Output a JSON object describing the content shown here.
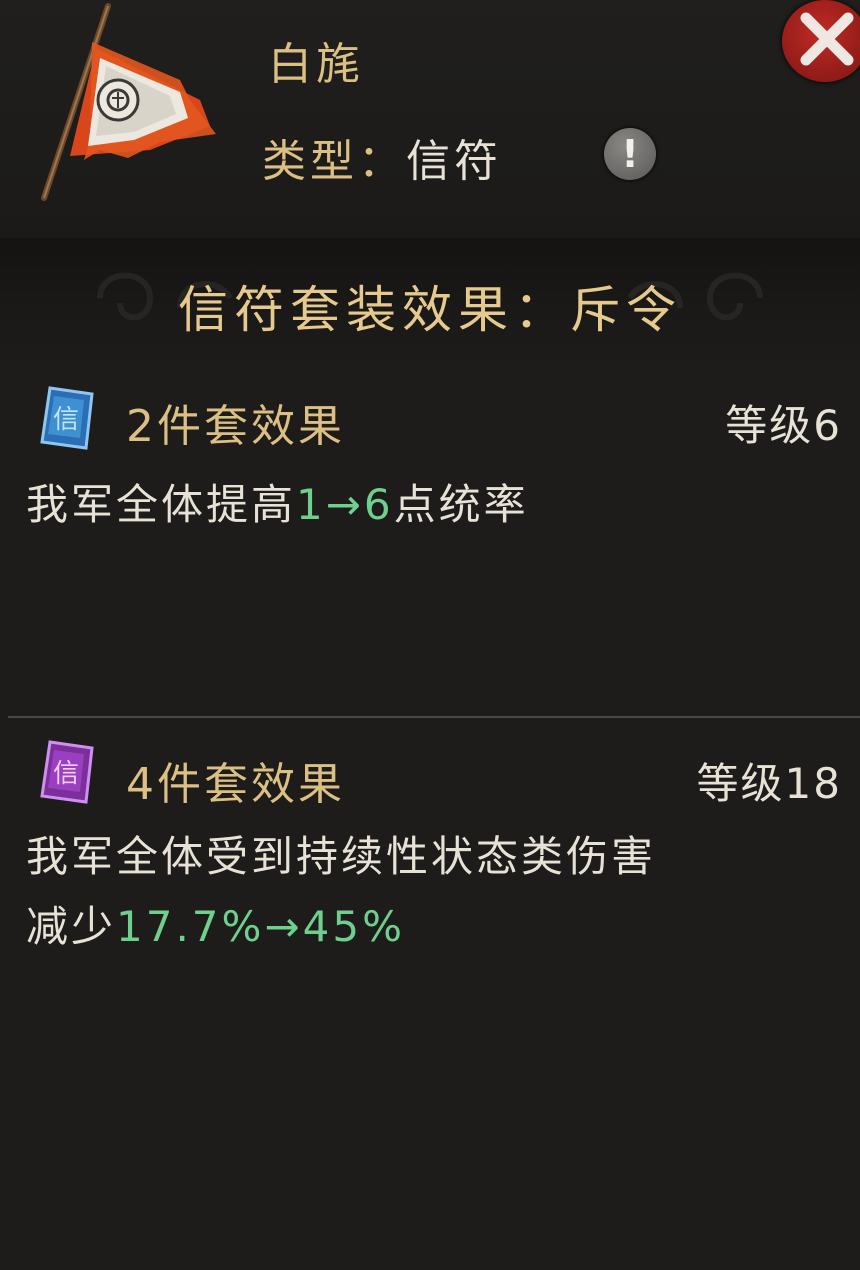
{
  "item": {
    "name": "白旄",
    "type_label": "类型：",
    "type_value": "信符",
    "icon": "white-banner-flag-icon"
  },
  "buttons": {
    "info_icon": "exclamation-icon",
    "info_text": "!",
    "close_icon": "close-x-icon"
  },
  "set": {
    "title": "信符套装效果：斥令"
  },
  "effects": [
    {
      "gem_icon": "blue-token-gem-icon",
      "title": "2件套效果",
      "level": "等级6",
      "desc_pre": "我军全体提高",
      "desc_value": "1→6",
      "desc_post": "点统率"
    },
    {
      "gem_icon": "purple-token-gem-icon",
      "title": "4件套效果",
      "level": "等级18",
      "desc_line1": "我军全体受到持续性状态类伤害",
      "desc_pre": "减少",
      "desc_value": "17.7%→45%"
    }
  ],
  "colors": {
    "gold_text": "#dcbf82",
    "white_text": "#e8e2d6",
    "highlight_green": "#6fcf8d",
    "close_red": "#c02a25"
  }
}
